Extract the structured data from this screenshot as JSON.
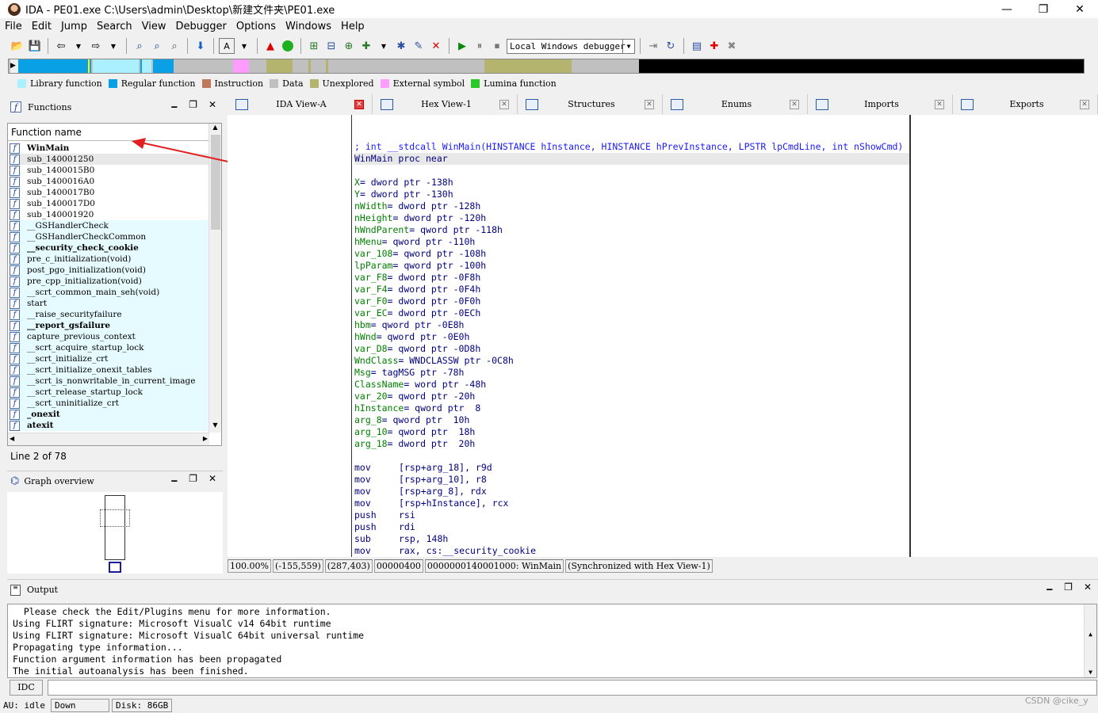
{
  "window": {
    "title": "IDA - PE01.exe C:\\Users\\admin\\Desktop\\新建文件夹\\PE01.exe",
    "minimize": "—",
    "maximize": "❐",
    "close": "✕"
  },
  "menu": [
    "File",
    "Edit",
    "Jump",
    "Search",
    "View",
    "Debugger",
    "Options",
    "Windows",
    "Help"
  ],
  "toolbar": {
    "debugger": "Local Windows debugger"
  },
  "legend": [
    {
      "label": "Library function",
      "color": "#aaf0ff"
    },
    {
      "label": "Regular function",
      "color": "#0aa0e6"
    },
    {
      "label": "Instruction",
      "color": "#c0785a"
    },
    {
      "label": "Data",
      "color": "#c0c0c0"
    },
    {
      "label": "Unexplored",
      "color": "#b4b46e"
    },
    {
      "label": "External symbol",
      "color": "#ff9cff"
    },
    {
      "label": "Lumina function",
      "color": "#28c828"
    }
  ],
  "functions_panel": {
    "title": "Functions",
    "column": "Function name",
    "status": "Line 2 of 78",
    "items": [
      {
        "name": "WinMain",
        "bold": true
      },
      {
        "name": "sub_140001250",
        "bold": false
      },
      {
        "name": "sub_1400015B0",
        "bold": false
      },
      {
        "name": "sub_1400016A0",
        "bold": false
      },
      {
        "name": "sub_1400017B0",
        "bold": false
      },
      {
        "name": "sub_1400017D0",
        "bold": false
      },
      {
        "name": "sub_140001920",
        "bold": false
      },
      {
        "name": "__GSHandlerCheck",
        "bold": false
      },
      {
        "name": "__GSHandlerCheckCommon",
        "bold": false
      },
      {
        "name": "__security_check_cookie",
        "bold": true
      },
      {
        "name": "pre_c_initialization(void)",
        "bold": false
      },
      {
        "name": "post_pgo_initialization(void)",
        "bold": false
      },
      {
        "name": "pre_cpp_initialization(void)",
        "bold": false
      },
      {
        "name": "__scrt_common_main_seh(void)",
        "bold": false
      },
      {
        "name": "start",
        "bold": false
      },
      {
        "name": "__raise_securityfailure",
        "bold": false
      },
      {
        "name": "__report_gsfailure",
        "bold": true
      },
      {
        "name": "capture_previous_context",
        "bold": false
      },
      {
        "name": "__scrt_acquire_startup_lock",
        "bold": false
      },
      {
        "name": "__scrt_initialize_crt",
        "bold": false
      },
      {
        "name": "__scrt_initialize_onexit_tables",
        "bold": false
      },
      {
        "name": "__scrt_is_nonwritable_in_current_image",
        "bold": false
      },
      {
        "name": "__scrt_release_startup_lock",
        "bold": false
      },
      {
        "name": "__scrt_uninitialize_crt",
        "bold": false
      },
      {
        "name": "_onexit",
        "bold": true
      },
      {
        "name": "atexit",
        "bold": true
      }
    ]
  },
  "graph_panel": {
    "title": "Graph overview"
  },
  "tabs": [
    {
      "label": "IDA View-A",
      "active": true
    },
    {
      "label": "Hex View-1",
      "active": false
    },
    {
      "label": "Structures",
      "active": false
    },
    {
      "label": "Enums",
      "active": false
    },
    {
      "label": "Imports",
      "active": false
    },
    {
      "label": "Exports",
      "active": false
    }
  ],
  "code": {
    "header": "; int __stdcall WinMain(HINSTANCE hInstance, HINSTANCE hPrevInstance, LPSTR lpCmdLine, int nShowCmd)",
    "proc": "WinMain proc near",
    "vars": [
      [
        "X",
        "= dword ptr -138h"
      ],
      [
        "Y",
        "= dword ptr -130h"
      ],
      [
        "nWidth",
        "= dword ptr -128h"
      ],
      [
        "nHeight",
        "= dword ptr -120h"
      ],
      [
        "hWndParent",
        "= qword ptr -118h"
      ],
      [
        "hMenu",
        "= qword ptr -110h"
      ],
      [
        "var_108",
        "= qword ptr -108h"
      ],
      [
        "lpParam",
        "= qword ptr -100h"
      ],
      [
        "var_F8",
        "= dword ptr -0F8h"
      ],
      [
        "var_F4",
        "= dword ptr -0F4h"
      ],
      [
        "var_F0",
        "= dword ptr -0F0h"
      ],
      [
        "var_EC",
        "= dword ptr -0ECh"
      ],
      [
        "hbm",
        "= qword ptr -0E8h"
      ],
      [
        "hWnd",
        "= qword ptr -0E0h"
      ],
      [
        "var_D8",
        "= qword ptr -0D8h"
      ],
      [
        "WndClass",
        "= WNDCLASSW ptr -0C8h"
      ],
      [
        "Msg",
        "= tagMSG ptr -78h"
      ],
      [
        "ClassName",
        "= word ptr -48h"
      ],
      [
        "var_20",
        "= qword ptr -20h"
      ],
      [
        "hInstance",
        "= qword ptr  8"
      ],
      [
        "arg_8",
        "= qword ptr  10h"
      ],
      [
        "arg_10",
        "= qword ptr  18h"
      ],
      [
        "arg_18",
        "= dword ptr  20h"
      ]
    ],
    "instructions": [
      [
        "mov",
        "[rsp+arg_18], r9d"
      ],
      [
        "mov",
        "[rsp+arg_10], r8"
      ],
      [
        "mov",
        "[rsp+arg_8], rdx"
      ],
      [
        "mov",
        "[rsp+hInstance], rcx"
      ],
      [
        "push",
        "rsi"
      ],
      [
        "push",
        "rdi"
      ],
      [
        "sub",
        "rsp, 148h"
      ],
      [
        "mov",
        "rax, cs:__security_cookie"
      ]
    ]
  },
  "status": [
    "100.00%",
    "(-155,559)",
    "(287,403)",
    "00000400",
    "0000000140001000: WinMain",
    "(Synchronized with Hex View-1)"
  ],
  "output": {
    "title": "Output",
    "lines": [
      "  Please check the Edit/Plugins menu for more information.",
      "Using FLIRT signature: Microsoft VisualC v14 64bit runtime",
      "Using FLIRT signature: Microsoft VisualC 64bit universal runtime",
      "Propagating type information...",
      "Function argument information has been propagated",
      "The initial autoanalysis has been finished."
    ],
    "idc_label": "IDC"
  },
  "bottom": {
    "au": "AU:  idle",
    "dir": "Down",
    "disk": "Disk: 86GB",
    "watermark": "CSDN @cike_y"
  }
}
